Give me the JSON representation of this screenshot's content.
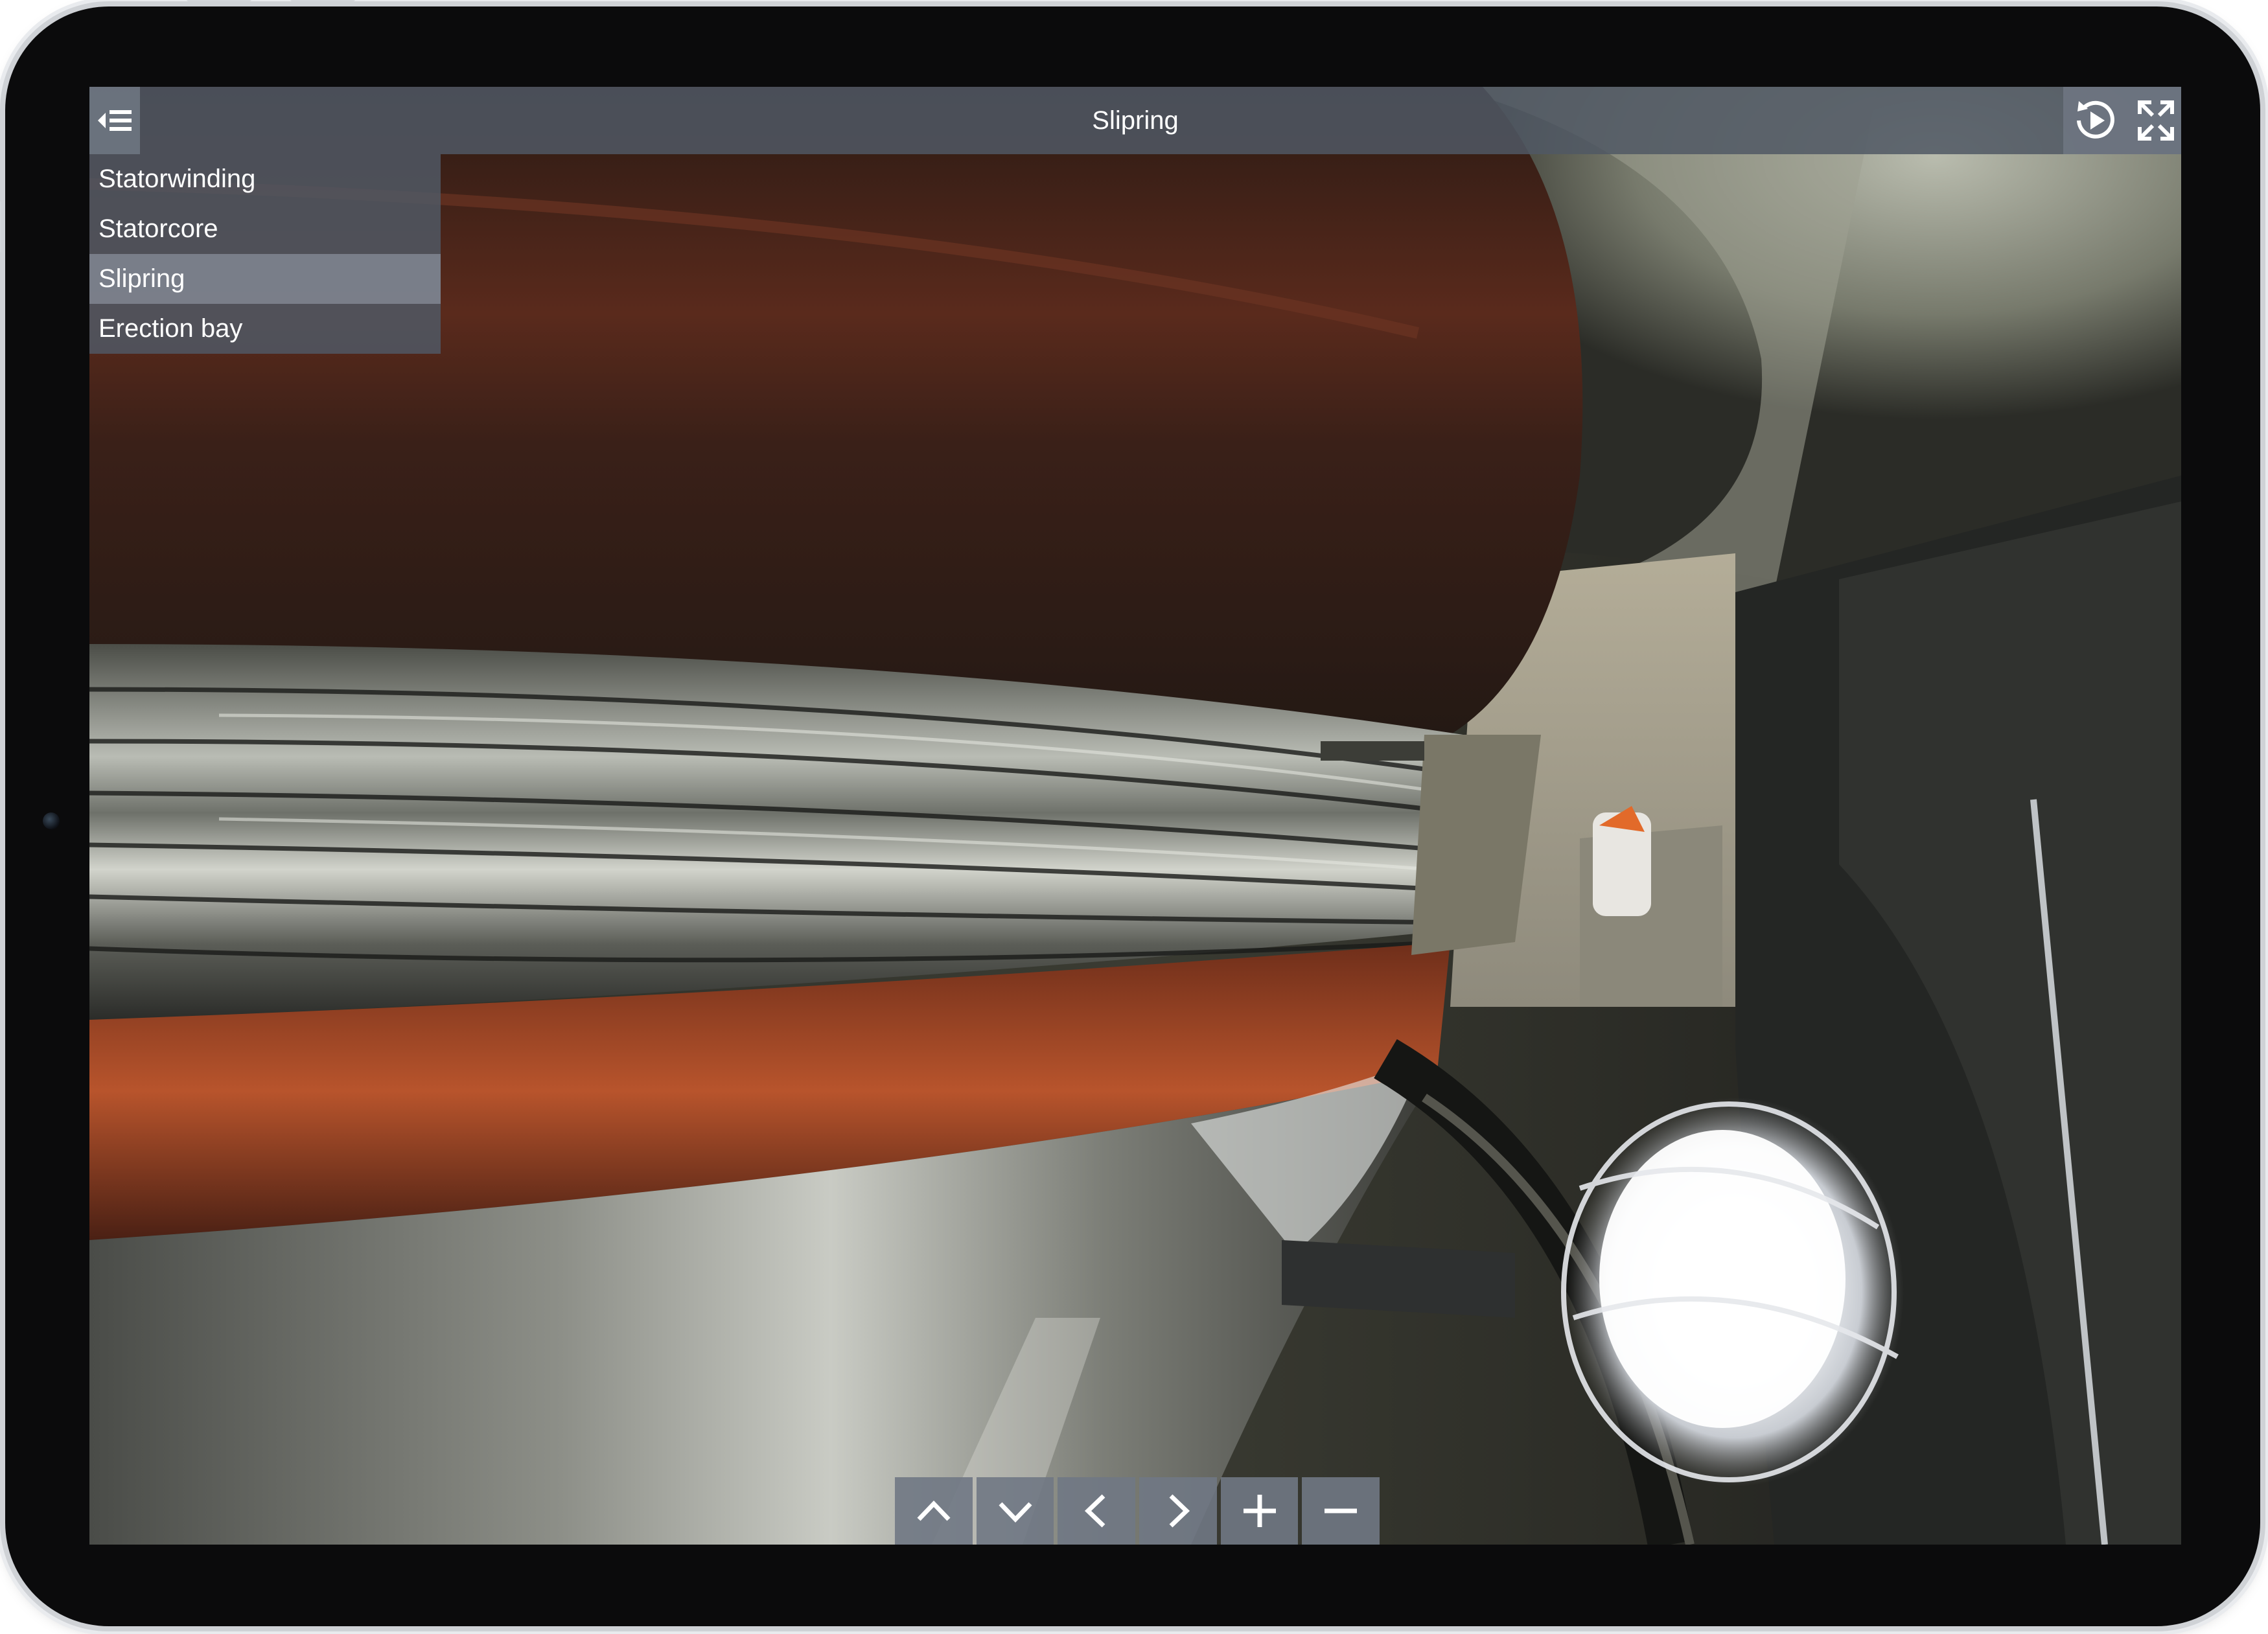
{
  "viewer": {
    "title": "Slipring",
    "scenes": [
      {
        "label": "Statorwinding",
        "active": false
      },
      {
        "label": "Statorcore",
        "active": false
      },
      {
        "label": "Slipring",
        "active": true
      },
      {
        "label": "Erection bay",
        "active": false
      }
    ],
    "icons": {
      "menu": "menu-collapse-icon",
      "autoplay": "autoplay-icon",
      "fullscreen": "fullscreen-icon",
      "up": "chevron-up-icon",
      "down": "chevron-down-icon",
      "left": "chevron-left-icon",
      "right": "chevron-right-icon",
      "zoom_in": "plus-icon",
      "zoom_out": "minus-icon"
    },
    "colors": {
      "bar": "#505864",
      "active_item": "#7d8692",
      "text": "#ffffff"
    }
  }
}
